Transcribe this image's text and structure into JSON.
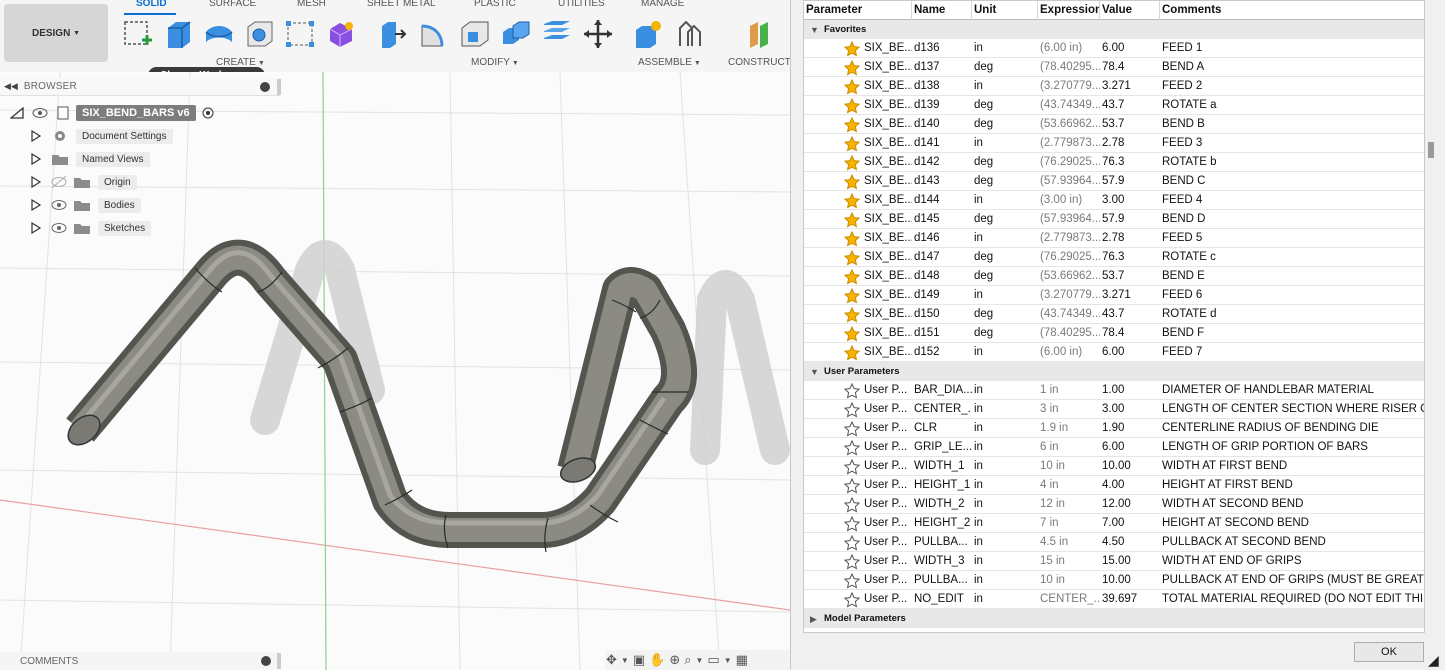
{
  "toolbar": {
    "workspace_button": "DESIGN",
    "tabs": [
      "SOLID",
      "SURFACE",
      "MESH",
      "SHEET METAL",
      "PLASTIC",
      "UTILITIES",
      "MANAGE"
    ],
    "groups": {
      "create": "CREATE",
      "modify": "MODIFY",
      "assemble": "ASSEMBLE",
      "construct": "CONSTRUCT"
    },
    "tooltip": "Change Workspace"
  },
  "browser": {
    "title": "BROWSER",
    "root": "SIX_BEND_BARS v6",
    "items": [
      "Document Settings",
      "Named Views",
      "Origin",
      "Bodies",
      "Sketches"
    ]
  },
  "comments": {
    "title": "COMMENTS"
  },
  "params": {
    "columns": [
      "Parameter",
      "Name",
      "Unit",
      "Expression",
      "Value",
      "Comments"
    ],
    "sections": [
      "Favorites",
      "User Parameters",
      "Model Parameters"
    ],
    "favorites": [
      {
        "param": "SIX_BE...",
        "name": "d136",
        "unit": "in",
        "expr": "(6.00 in)",
        "value": "6.00",
        "comment": "FEED 1"
      },
      {
        "param": "SIX_BE...",
        "name": "d137",
        "unit": "deg",
        "expr": "(78.40295...",
        "value": "78.4",
        "comment": "BEND A"
      },
      {
        "param": "SIX_BE...",
        "name": "d138",
        "unit": "in",
        "expr": "(3.270779...",
        "value": "3.271",
        "comment": "FEED 2"
      },
      {
        "param": "SIX_BE...",
        "name": "d139",
        "unit": "deg",
        "expr": "(43.74349...",
        "value": "43.7",
        "comment": "ROTATE a"
      },
      {
        "param": "SIX_BE...",
        "name": "d140",
        "unit": "deg",
        "expr": "(53.66962...",
        "value": "53.7",
        "comment": "BEND B"
      },
      {
        "param": "SIX_BE...",
        "name": "d141",
        "unit": "in",
        "expr": "(2.779873...",
        "value": "2.78",
        "comment": "FEED 3"
      },
      {
        "param": "SIX_BE...",
        "name": "d142",
        "unit": "deg",
        "expr": "(76.29025...",
        "value": "76.3",
        "comment": "ROTATE b"
      },
      {
        "param": "SIX_BE...",
        "name": "d143",
        "unit": "deg",
        "expr": "(57.93964...",
        "value": "57.9",
        "comment": "BEND C"
      },
      {
        "param": "SIX_BE...",
        "name": "d144",
        "unit": "in",
        "expr": "(3.00 in)",
        "value": "3.00",
        "comment": "FEED 4"
      },
      {
        "param": "SIX_BE...",
        "name": "d145",
        "unit": "deg",
        "expr": "(57.93964...",
        "value": "57.9",
        "comment": "BEND D"
      },
      {
        "param": "SIX_BE...",
        "name": "d146",
        "unit": "in",
        "expr": "(2.779873...",
        "value": "2.78",
        "comment": "FEED 5"
      },
      {
        "param": "SIX_BE...",
        "name": "d147",
        "unit": "deg",
        "expr": "(76.29025...",
        "value": "76.3",
        "comment": "ROTATE c"
      },
      {
        "param": "SIX_BE...",
        "name": "d148",
        "unit": "deg",
        "expr": "(53.66962...",
        "value": "53.7",
        "comment": "BEND E"
      },
      {
        "param": "SIX_BE...",
        "name": "d149",
        "unit": "in",
        "expr": "(3.270779...",
        "value": "3.271",
        "comment": "FEED 6"
      },
      {
        "param": "SIX_BE...",
        "name": "d150",
        "unit": "deg",
        "expr": "(43.74349...",
        "value": "43.7",
        "comment": "ROTATE d"
      },
      {
        "param": "SIX_BE...",
        "name": "d151",
        "unit": "deg",
        "expr": "(78.40295...",
        "value": "78.4",
        "comment": "BEND F"
      },
      {
        "param": "SIX_BE...",
        "name": "d152",
        "unit": "in",
        "expr": "(6.00 in)",
        "value": "6.00",
        "comment": "FEED 7"
      }
    ],
    "user": [
      {
        "param": "User P...",
        "name": "BAR_DIA...",
        "unit": "in",
        "expr": "1 in",
        "value": "1.00",
        "comment": "DIAMETER OF HANDLEBAR MATERIAL"
      },
      {
        "param": "User P...",
        "name": "CENTER_...",
        "unit": "in",
        "expr": "3 in",
        "value": "3.00",
        "comment": "LENGTH OF CENTER SECTION WHERE RISER GRIP..."
      },
      {
        "param": "User P...",
        "name": "CLR",
        "unit": "in",
        "expr": "1.9 in",
        "value": "1.90",
        "comment": "CENTERLINE RADIUS OF BENDING DIE"
      },
      {
        "param": "User P...",
        "name": "GRIP_LE...",
        "unit": "in",
        "expr": "6 in",
        "value": "6.00",
        "comment": "LENGTH OF GRIP PORTION OF BARS"
      },
      {
        "param": "User P...",
        "name": "WIDTH_1",
        "unit": "in",
        "expr": "10 in",
        "value": "10.00",
        "comment": "WIDTH AT FIRST BEND"
      },
      {
        "param": "User P...",
        "name": "HEIGHT_1",
        "unit": "in",
        "expr": "4 in",
        "value": "4.00",
        "comment": "HEIGHT AT FIRST BEND"
      },
      {
        "param": "User P...",
        "name": "WIDTH_2",
        "unit": "in",
        "expr": "12 in",
        "value": "12.00",
        "comment": "WIDTH AT SECOND BEND"
      },
      {
        "param": "User P...",
        "name": "HEIGHT_2",
        "unit": "in",
        "expr": "7 in",
        "value": "7.00",
        "comment": "HEIGHT AT SECOND BEND"
      },
      {
        "param": "User P...",
        "name": "PULLBA...",
        "unit": "in",
        "expr": "4.5 in",
        "value": "4.50",
        "comment": "PULLBACK AT SECOND BEND"
      },
      {
        "param": "User P...",
        "name": "WIDTH_3",
        "unit": "in",
        "expr": "15 in",
        "value": "15.00",
        "comment": "WIDTH AT END OF GRIPS"
      },
      {
        "param": "User P...",
        "name": "PULLBA...",
        "unit": "in",
        "expr": "10 in",
        "value": "10.00",
        "comment": "PULLBACK AT END OF GRIPS (MUST BE GREATER ..."
      },
      {
        "param": "User P...",
        "name": "NO_EDIT",
        "unit": "in",
        "expr": "CENTER_...",
        "value": "39.697",
        "comment": "TOTAL MATERIAL REQUIRED (DO NOT EDIT THIS R..."
      }
    ],
    "ok": "OK"
  },
  "colors": {
    "accent": "#0a6fd1",
    "star": "#f4b400",
    "tube": "#6e6e68",
    "x_axis": "#e8a0a0",
    "y_axis": "#8fd08f"
  }
}
